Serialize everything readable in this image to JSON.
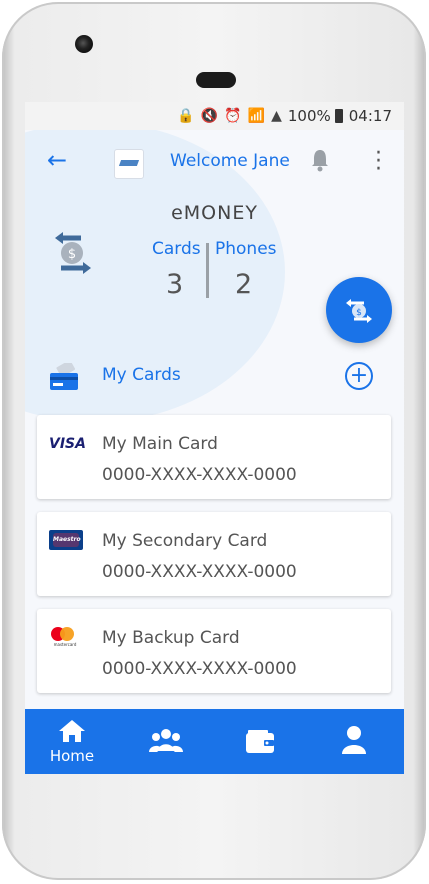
{
  "status_bar": {
    "battery": "100%",
    "time": "04:17"
  },
  "header": {
    "welcome_text": "Welcome Jane"
  },
  "summary": {
    "title": "eMONEY",
    "cards_label": "Cards",
    "cards_count": "3",
    "phones_label": "Phones",
    "phones_count": "2"
  },
  "my_cards": {
    "label": "My Cards",
    "items": [
      {
        "brand": "VISA",
        "name": "My Main Card",
        "number": "0000-XXXX-XXXX-0000"
      },
      {
        "brand": "Maestro",
        "name": "My Secondary Card",
        "number": "0000-XXXX-XXXX-0000"
      },
      {
        "brand": "mastercard",
        "name": "My Backup Card",
        "number": "0000-XXXX-XXXX-0000"
      }
    ]
  },
  "bottom_nav": {
    "items": [
      {
        "label": "Home",
        "icon": "home-icon"
      },
      {
        "label": "",
        "icon": "users-icon"
      },
      {
        "label": "",
        "icon": "wallet-icon"
      },
      {
        "label": "",
        "icon": "user-icon"
      }
    ]
  },
  "colors": {
    "accent": "#1a73e8",
    "text": "#555555"
  }
}
